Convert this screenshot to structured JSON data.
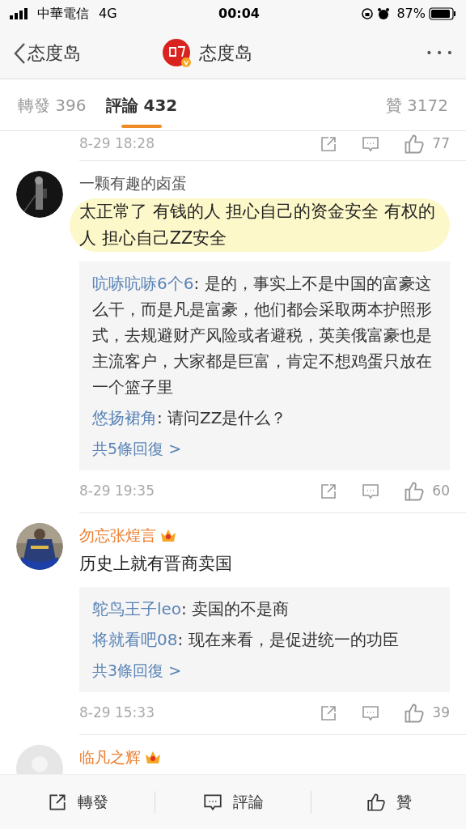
{
  "status_bar": {
    "carrier": "中華電信",
    "network": "4G",
    "time": "00:04",
    "battery": "87%"
  },
  "nav": {
    "back_label": "态度岛",
    "title": "态度岛",
    "more": "• • •"
  },
  "tabs": [
    {
      "label": "轉發 396",
      "selected": false
    },
    {
      "label": "評論 432",
      "selected": true
    },
    {
      "label": "贊 3172",
      "selected": false
    }
  ],
  "previous_footer": {
    "time": "8-29 18:28",
    "likes": "77"
  },
  "comments": [
    {
      "avatar": {
        "kind": "picture"
      },
      "user": "一颗有趣的卤蛋",
      "vip": false,
      "highlighted": true,
      "text": "太正常了 有钱的人 担心自己的资金安全 有权的人 担心自己ZZ安全",
      "replies": [
        {
          "user": "吭哧吭哧6个6",
          "text": ": 是的，事实上不是中国的富豪这么干，而是凡是富豪，他们都会采取两本护照形式，去规避财产风险或者避税，英美俄富豪也是主流客户，大家都是巨富，肯定不想鸡蛋只放在一个篮子里"
        },
        {
          "user": "悠扬裙角",
          "text": ": 请问ZZ是什么？"
        }
      ],
      "more_replies": "共5條回復 >",
      "time": "8-29 19:35",
      "likes": "60"
    },
    {
      "avatar": {
        "kind": "picture"
      },
      "user": "勿忘张煌言",
      "vip": true,
      "highlighted": false,
      "text": "历史上就有晋商卖国",
      "replies": [
        {
          "user": "鸵鸟王子leo",
          "text": ": 卖国的不是商"
        },
        {
          "user": "将就看吧08",
          "text": ": 现在来看，是促进统一的功臣"
        }
      ],
      "more_replies": "共3條回復 >",
      "time": "8-29 15:33",
      "likes": "39"
    },
    {
      "avatar": {
        "kind": "default"
      },
      "user": "临凡之辉",
      "vip": true
    }
  ],
  "bottom_bar": [
    {
      "kind": "repost",
      "label": "轉發"
    },
    {
      "kind": "comment",
      "label": "評論"
    },
    {
      "kind": "like",
      "label": "贊"
    }
  ]
}
